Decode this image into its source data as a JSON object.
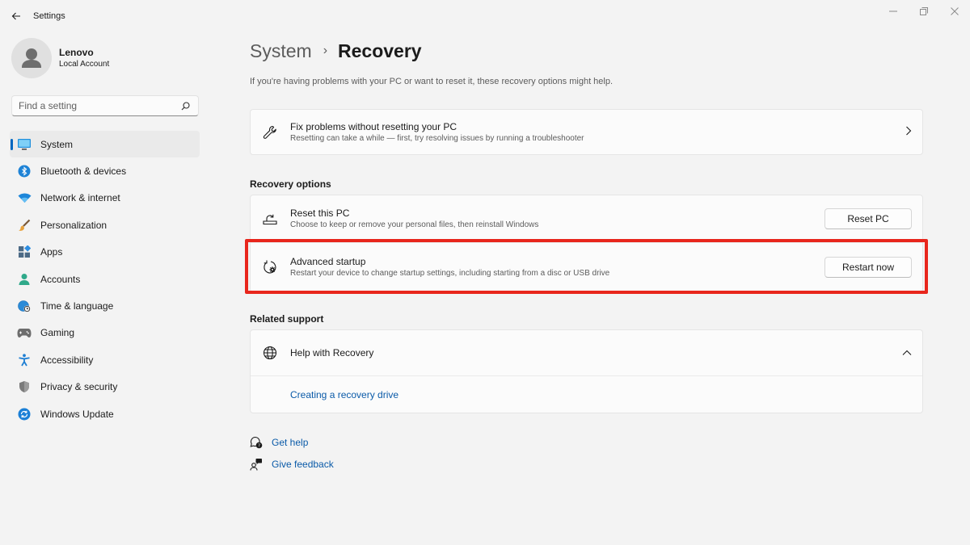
{
  "window": {
    "title": "Settings",
    "back_icon": "back-arrow-icon",
    "controls": [
      "minimize-icon",
      "maximize-icon",
      "close-icon"
    ]
  },
  "profile": {
    "name": "Lenovo",
    "account_type": "Local Account"
  },
  "search": {
    "placeholder": "Find a setting",
    "value": ""
  },
  "sidebar": {
    "items": [
      {
        "label": "System",
        "icon": "display-icon",
        "active": true
      },
      {
        "label": "Bluetooth & devices",
        "icon": "bluetooth-icon"
      },
      {
        "label": "Network & internet",
        "icon": "wifi-icon"
      },
      {
        "label": "Personalization",
        "icon": "brush-icon"
      },
      {
        "label": "Apps",
        "icon": "apps-icon"
      },
      {
        "label": "Accounts",
        "icon": "person-icon"
      },
      {
        "label": "Time & language",
        "icon": "globe-clock-icon"
      },
      {
        "label": "Gaming",
        "icon": "gamepad-icon"
      },
      {
        "label": "Accessibility",
        "icon": "accessibility-icon"
      },
      {
        "label": "Privacy & security",
        "icon": "shield-icon"
      },
      {
        "label": "Windows Update",
        "icon": "update-icon"
      }
    ]
  },
  "main": {
    "breadcrumb": {
      "parent": "System",
      "separator": "›",
      "current": "Recovery"
    },
    "description": "If you're having problems with your PC or want to reset it, these recovery options might help.",
    "fix_card": {
      "title": "Fix problems without resetting your PC",
      "subtitle": "Resetting can take a while — first, try resolving issues by running a troubleshooter",
      "icon": "wrench-icon"
    },
    "recovery_options": {
      "heading": "Recovery options",
      "reset": {
        "title": "Reset this PC",
        "subtitle": "Choose to keep or remove your personal files, then reinstall Windows",
        "button": "Reset PC",
        "icon": "reset-pc-icon"
      },
      "advanced": {
        "title": "Advanced startup",
        "subtitle": "Restart your device to change startup settings, including starting from a disc or USB drive",
        "button": "Restart now",
        "icon": "advanced-startup-icon",
        "highlight_color": "#e8261c"
      }
    },
    "related_support": {
      "heading": "Related support",
      "help": {
        "title": "Help with Recovery",
        "icon": "globe-icon",
        "expanded": true
      },
      "link": "Creating a recovery drive"
    },
    "footer": {
      "get_help": "Get help",
      "give_feedback": "Give feedback"
    }
  },
  "colors": {
    "accent": "#0067c0",
    "link": "#0a5aa8",
    "background": "#f3f3f3",
    "card": "#fbfbfb"
  }
}
